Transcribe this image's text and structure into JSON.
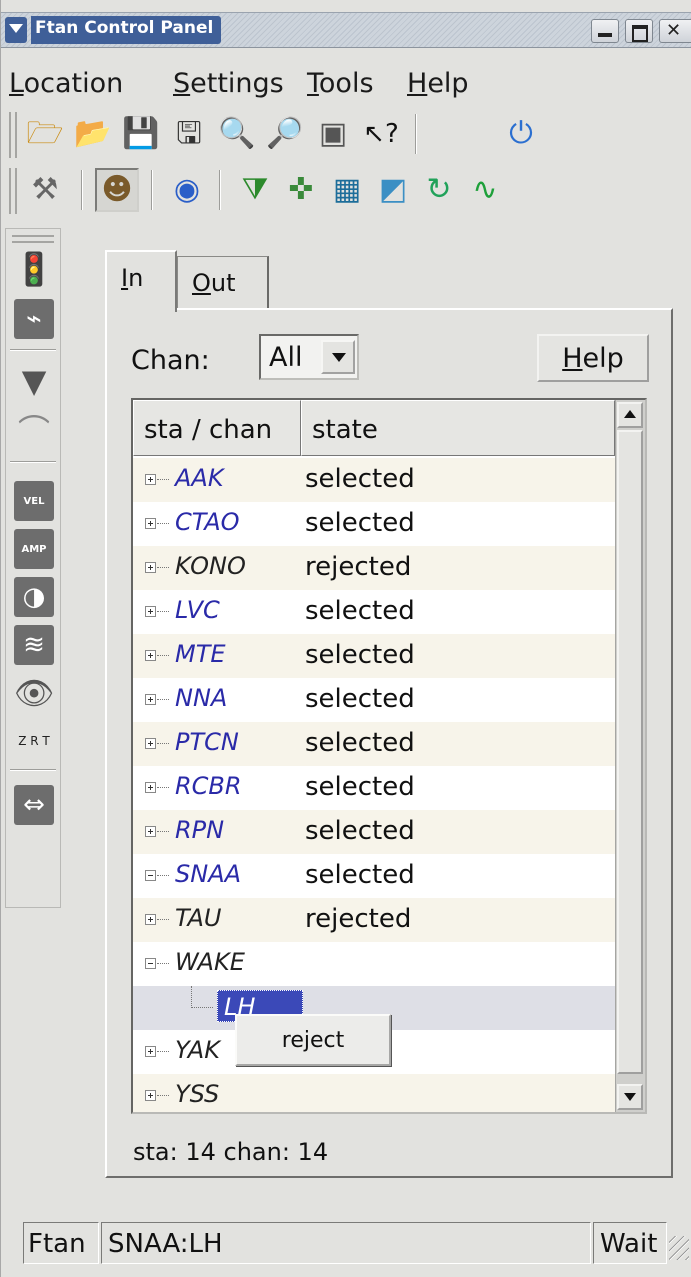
{
  "window": {
    "title": "Ftan Control Panel",
    "accent_color": "#3f5f98"
  },
  "menubar": {
    "items": [
      {
        "mnemonic": "L",
        "rest": "ocation"
      },
      {
        "mnemonic": "S",
        "rest": "ettings"
      },
      {
        "mnemonic": "T",
        "rest": "ools"
      },
      {
        "mnemonic": "H",
        "rest": "elp"
      }
    ]
  },
  "toolbar1": {
    "icons": [
      "new-icon",
      "open-icon",
      "save-icon",
      "save-as-icon",
      "zoom-in-icon",
      "zoom-out-icon",
      "zoom-reset-icon",
      "whats-this-icon",
      "power-icon"
    ]
  },
  "toolbar2": {
    "icons": [
      "tools-icon",
      "operator-icon",
      "compass-icon",
      "filter-icon",
      "crosshair-icon",
      "rt-spectrum-icon",
      "rt-curve-icon",
      "green-spiral-icon",
      "sine-wave-icon"
    ]
  },
  "vtoolbar": {
    "icons": [
      "traffic-light-icon",
      "waveform-icon",
      "funnel-icon",
      "ridge-icon",
      "vel-icon",
      "amp-icon",
      "compass-small-icon",
      "spectrum-icon",
      "eye-icon",
      "zrt-icon",
      "waveform-align-icon"
    ],
    "vel_label": "VEL",
    "amp_label": "AMP",
    "zrt_label": "Z R T"
  },
  "tabs": {
    "in": {
      "mnemonic": "I",
      "rest": "n"
    },
    "out": {
      "mnemonic": "O",
      "rest": "ut"
    }
  },
  "filter": {
    "chan_label": "Chan:",
    "chan_value": "All"
  },
  "help_button": {
    "mnemonic": "H",
    "rest": "elp"
  },
  "list": {
    "headers": {
      "sta_chan": "sta / chan",
      "state": "state"
    },
    "rows": [
      {
        "sta": "AAK",
        "state": "selected",
        "expander": "plus"
      },
      {
        "sta": "CTAO",
        "state": "selected",
        "expander": "plus"
      },
      {
        "sta": "KONO",
        "state": "rejected",
        "expander": "plus"
      },
      {
        "sta": "LVC",
        "state": "selected",
        "expander": "plus"
      },
      {
        "sta": "MTE",
        "state": "selected",
        "expander": "plus"
      },
      {
        "sta": "NNA",
        "state": "selected",
        "expander": "plus"
      },
      {
        "sta": "PTCN",
        "state": "selected",
        "expander": "plus"
      },
      {
        "sta": "RCBR",
        "state": "selected",
        "expander": "plus"
      },
      {
        "sta": "RPN",
        "state": "selected",
        "expander": "plus"
      },
      {
        "sta": "SNAA",
        "state": "selected",
        "expander": "minus"
      },
      {
        "sta": "TAU",
        "state": "rejected",
        "expander": "plus"
      },
      {
        "sta": "WAKE",
        "state": "",
        "expander": "minus"
      },
      {
        "sta": "LH",
        "state": "",
        "expander": "child"
      },
      {
        "sta": "YAK",
        "state": "",
        "expander": "plus"
      },
      {
        "sta": "YSS",
        "state": "",
        "expander": "plus"
      }
    ]
  },
  "popup": {
    "reject_label": "reject"
  },
  "summary": "sta: 14 chan: 14",
  "statusbar": {
    "app": "Ftan",
    "selection": "SNAA:LH",
    "status": "Wait"
  }
}
